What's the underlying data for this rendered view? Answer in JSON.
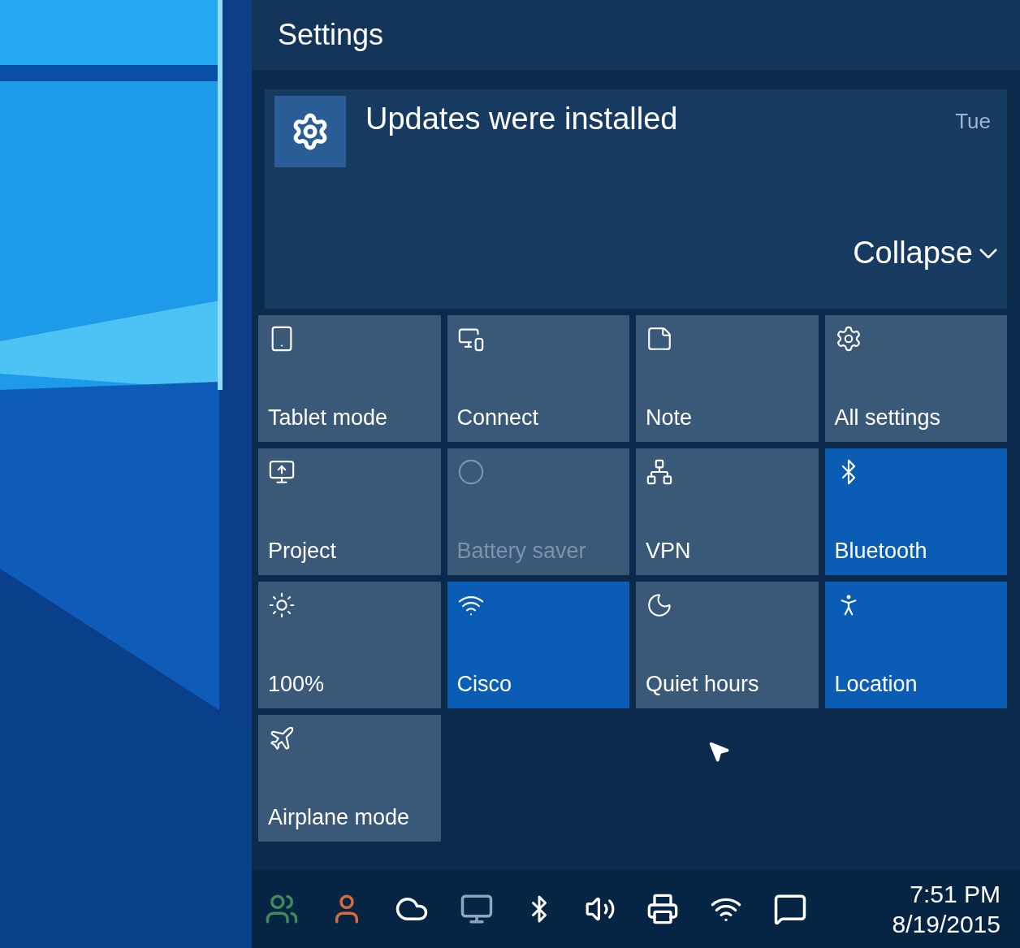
{
  "header": {
    "title": "Settings"
  },
  "notification": {
    "title": "Updates were installed",
    "time": "Tue",
    "collapse": "Collapse"
  },
  "tiles": [
    {
      "label": "Tablet mode",
      "kind": "tablet",
      "on": false,
      "disabled": false
    },
    {
      "label": "Connect",
      "kind": "connect",
      "on": false,
      "disabled": false
    },
    {
      "label": "Note",
      "kind": "note",
      "on": false,
      "disabled": false
    },
    {
      "label": "All settings",
      "kind": "settings",
      "on": false,
      "disabled": false
    },
    {
      "label": "Project",
      "kind": "project",
      "on": false,
      "disabled": false
    },
    {
      "label": "Battery saver",
      "kind": "battery",
      "on": false,
      "disabled": true
    },
    {
      "label": "VPN",
      "kind": "vpn",
      "on": false,
      "disabled": false
    },
    {
      "label": "Bluetooth",
      "kind": "bluetooth",
      "on": true,
      "disabled": false
    },
    {
      "label": "100%",
      "kind": "brightness",
      "on": false,
      "disabled": false
    },
    {
      "label": "Cisco",
      "kind": "wifi",
      "on": true,
      "disabled": false
    },
    {
      "label": "Quiet hours",
      "kind": "moon",
      "on": false,
      "disabled": false
    },
    {
      "label": "Location",
      "kind": "location",
      "on": true,
      "disabled": false
    },
    {
      "label": "Airplane mode",
      "kind": "airplane",
      "on": false,
      "disabled": false
    }
  ],
  "taskbar": {
    "time": "7:51 PM",
    "date": "8/19/2015"
  }
}
